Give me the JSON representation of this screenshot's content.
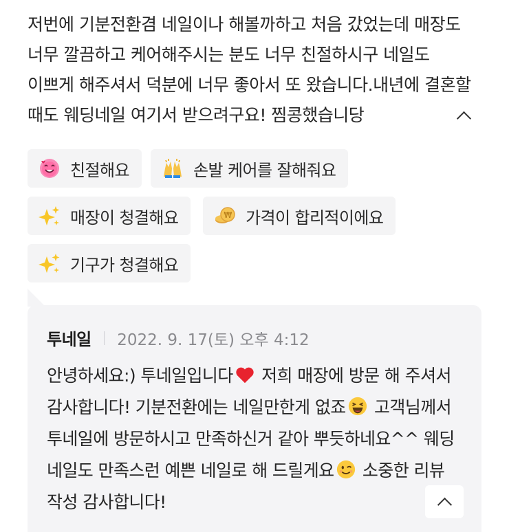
{
  "review": {
    "text": "저번에 기분전환겸 네일이나 해볼까하고 처음 갔었는데 매장도 너무 깔끔하고 케어해주시는 분도 너무 친절하시구 네일도 이쁘게 해주셔서 덕분에 너무 좋아서 또 왔습니다.내년에 결혼할 때도 웨딩네일 여기서 받으려구요! 찜콩했습니당",
    "collapse_icon": "chevron-up-icon"
  },
  "keywords": [
    {
      "label": "친절해요",
      "icon": "smiling-heart-face-icon"
    },
    {
      "label": "손발 케어를 잘해줘요",
      "icon": "raising-hands-icon"
    },
    {
      "label": "매장이 청결해요",
      "icon": "sparkles-icon"
    },
    {
      "label": "가격이 합리적이에요",
      "icon": "coin-icon"
    },
    {
      "label": "기구가 청결해요",
      "icon": "sparkles-icon"
    }
  ],
  "reply": {
    "owner": "투네일",
    "date": "2022. 9. 17(토) 오후 4:12",
    "text_1": "안녕하세요:) 투네일입니다",
    "text_2": " 저희 매장에 방문 해 주셔서 감사합니다! 기분전환에는 네일만한게 없죠",
    "text_3": " 고객님께서 투네일에 방문하시고 만족하신거 같아 뿌듯하네요^^ 웨딩 네일도 만족스런 예쁜 네일로 해 드릴게요",
    "text_4": " 소중한 리뷰 작성 감사합니다!",
    "emojis": [
      "red-heart-icon",
      "laughing-face-icon",
      "winking-face-icon"
    ]
  },
  "colors": {
    "chip_bg": "#f4f4f5",
    "reply_bg": "#f4f4f6",
    "date": "#8a8a8e"
  }
}
